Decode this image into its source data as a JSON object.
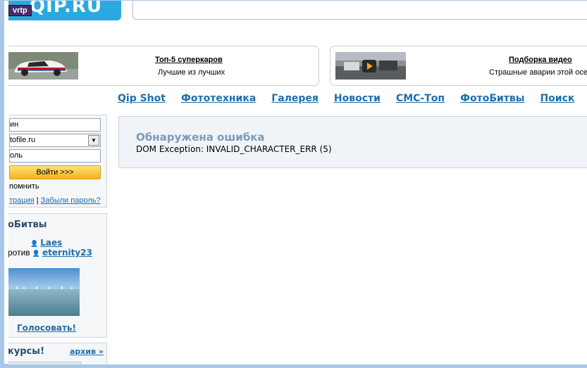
{
  "header": {
    "logo_text": "QIP.RU",
    "badge": "vrtp",
    "search_placeholder": ""
  },
  "promos": [
    {
      "title": "Топ-5 суперкаров",
      "subtitle": "Лучшие из лучших"
    },
    {
      "title": "Подборка видео",
      "subtitle": "Страшные аварии этой осе"
    }
  ],
  "nav": [
    "Qip Shot",
    "Фототехника",
    "Галерея",
    "Новости",
    "СМС-Топ",
    "ФотоБитвы",
    "Поиск"
  ],
  "login": {
    "login_field": "ин",
    "domain_select": "tofile.ru",
    "password_field": "оль",
    "submit": "Войти >>>",
    "remember": "помнить",
    "register_link": "трация",
    "separator": "|",
    "forgot_link": "Забыли пароль?"
  },
  "battles": {
    "title": "оБитвы",
    "user1": "Laes",
    "versus": "ротив",
    "user2": "eternity23",
    "vote": "Голосовать!"
  },
  "contests": {
    "title": "курсы!",
    "archive": "архив »"
  },
  "error": {
    "title": "Обнаружена ошибка",
    "message": "DOM Exception: INVALID_CHARACTER_ERR (5)"
  },
  "colors": {
    "link": "#1f6fa8",
    "logo_bg": "#2aa9e0",
    "frame": "#a9c7e8",
    "error_title": "#7e9bb8"
  }
}
